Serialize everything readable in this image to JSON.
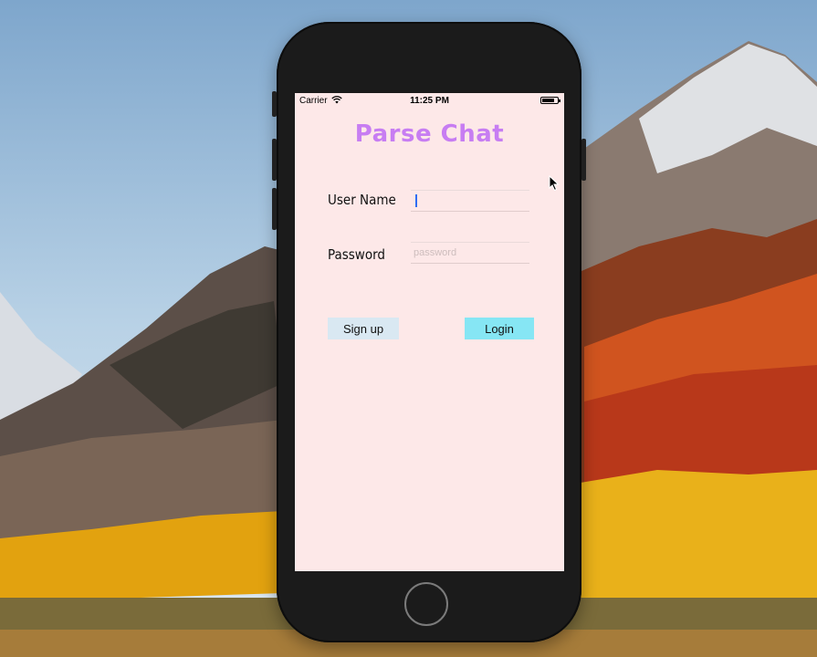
{
  "status_bar": {
    "carrier": "Carrier",
    "time": "11:25 PM"
  },
  "app": {
    "title": "Parse Chat",
    "username_label": "User Name",
    "username_value": "",
    "password_label": "Password",
    "password_placeholder": "password",
    "signup_label": "Sign up",
    "login_label": "Login"
  },
  "colors": {
    "title": "#c77df2",
    "screen_background": "#fde8e8",
    "signup_button": "#d9e8f2",
    "login_button": "#86e6f4"
  }
}
